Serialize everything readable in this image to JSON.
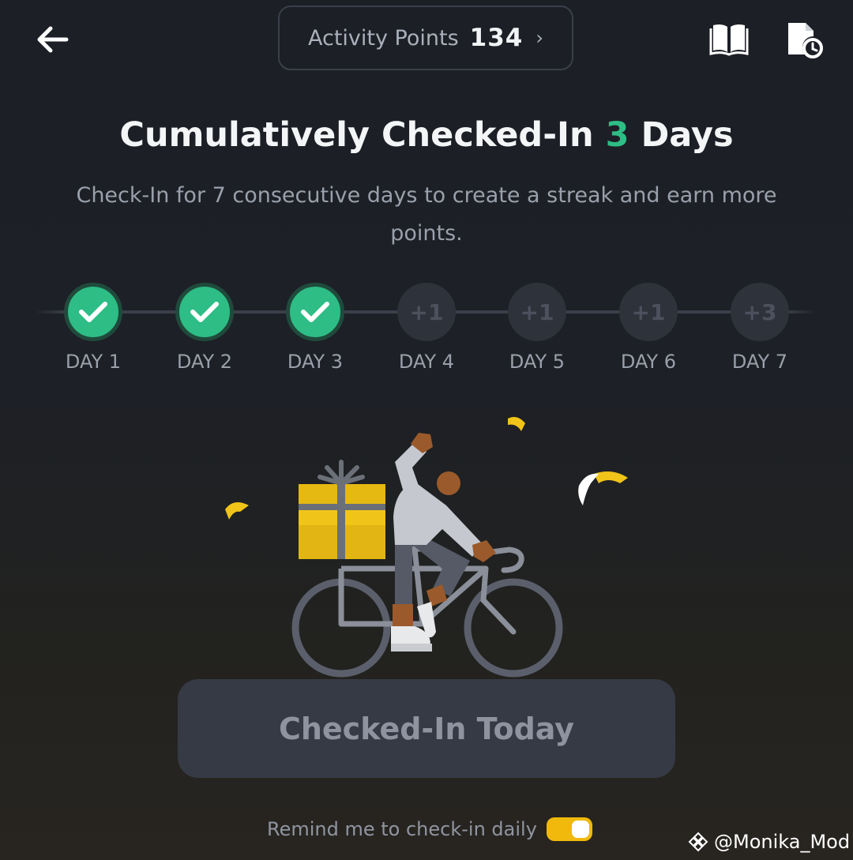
{
  "header": {
    "activity_points_label": "Activity Points",
    "activity_points_value": "134",
    "activity_points_chevron": "›",
    "icons": {
      "back": "back-arrow-icon",
      "guide": "book-icon",
      "history": "history-icon"
    }
  },
  "headline": {
    "prefix": "Cumulatively Checked-In",
    "count": "3",
    "suffix": "Days"
  },
  "subtext": "Check-In for 7 consecutive days to create a streak and earn more points.",
  "streak": {
    "days": [
      {
        "label": "DAY 1",
        "status": "checked",
        "bonus": ""
      },
      {
        "label": "DAY 2",
        "status": "checked",
        "bonus": ""
      },
      {
        "label": "DAY 3",
        "status": "checked",
        "bonus": ""
      },
      {
        "label": "DAY 4",
        "status": "pending",
        "bonus": "+1"
      },
      {
        "label": "DAY 5",
        "status": "pending",
        "bonus": "+1"
      },
      {
        "label": "DAY 6",
        "status": "pending",
        "bonus": "+1"
      },
      {
        "label": "DAY 7",
        "status": "pending",
        "bonus": "+3"
      }
    ]
  },
  "action_button": {
    "label": "Checked-In Today",
    "state": "disabled"
  },
  "reminder": {
    "label": "Remind me to check-in daily",
    "enabled": true
  },
  "watermark": "@Monika_Mod",
  "colors": {
    "accent_green": "#2ebd85",
    "accent_yellow": "#f0b90b",
    "background": "#1c1f26"
  }
}
